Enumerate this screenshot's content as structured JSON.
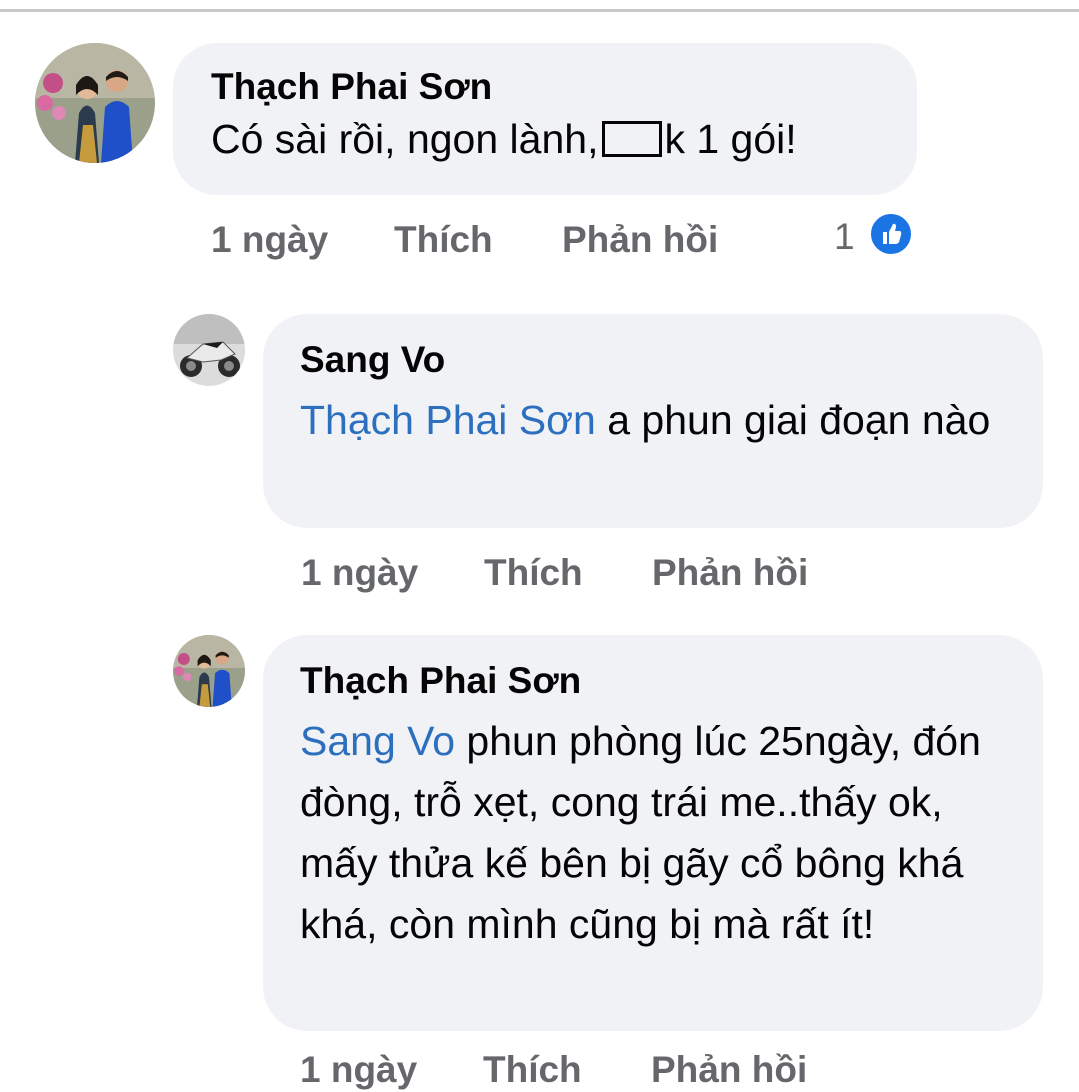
{
  "comments": [
    {
      "author": "Thạch Phai Sơn",
      "text_before": "Có sài rồi, ngon lành,",
      "text_after": "k 1 gói!",
      "time": "1 ngày",
      "like_label": "Thích",
      "reply_label": "Phản hồi",
      "reaction_count": "1",
      "reaction_icon": "like-icon"
    },
    {
      "author": "Sang Vo",
      "mention": "Thạch Phai Sơn",
      "text": " a phun giai đoạn nào",
      "time": "1 ngày",
      "like_label": "Thích",
      "reply_label": "Phản hồi"
    },
    {
      "author": "Thạch Phai Sơn",
      "mention": "Sang Vo",
      "text": " phun phòng lúc 25ngày, đón đòng, trỗ xẹt, cong trái me..thấy ok, mấy thửa kế bên bị gãy cổ bông khá khá, còn mình cũng bị mà rất ít!",
      "time": "1 ngày",
      "like_label": "Thích",
      "reply_label": "Phản hồi"
    }
  ],
  "colors": {
    "bubble": "#f0f2f5",
    "mention": "#2d6fbf",
    "meta": "#65676b",
    "like_badge": "#1b74e4"
  }
}
